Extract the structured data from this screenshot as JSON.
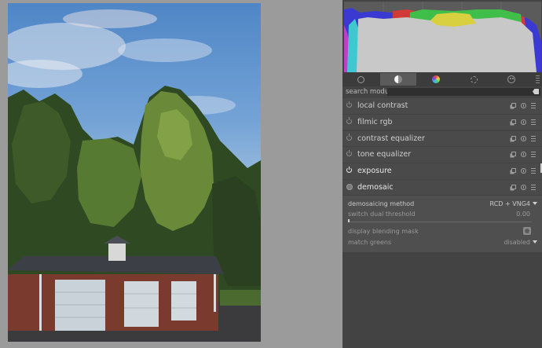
{
  "panel": {
    "search": {
      "label": "search module",
      "placeholder": ""
    },
    "tabs": [
      {
        "icon": "power-icon",
        "active": false
      },
      {
        "icon": "active-modules-icon",
        "active": true
      },
      {
        "icon": "color-icon",
        "active": false
      },
      {
        "icon": "correct-icon",
        "active": false
      },
      {
        "icon": "effect-icon",
        "active": false
      }
    ],
    "modules": [
      {
        "label": "local contrast",
        "state": "off"
      },
      {
        "label": "filmic rgb",
        "state": "off"
      },
      {
        "label": "contrast equalizer",
        "state": "off"
      },
      {
        "label": "tone equalizer",
        "state": "off"
      },
      {
        "label": "exposure",
        "state": "on"
      },
      {
        "label": "demosaic",
        "state": "always-on"
      }
    ],
    "demosaic": {
      "method_label": "demosaicing method",
      "method_value": "RCD + VNG4",
      "threshold_label": "switch dual threshold",
      "threshold_value": "0.00",
      "blend_mask_label": "display blending mask",
      "match_greens_label": "match greens",
      "match_greens_value": "disabled"
    }
  },
  "colors": {
    "panel_bg": "#434343",
    "histogram_red": "#d23a3a",
    "histogram_green": "#3fbf4a",
    "histogram_blue": "#3a3ad2",
    "histogram_yellow": "#d8d040",
    "histogram_cyan": "#40c8d0",
    "histogram_magenta": "#c040c8"
  }
}
